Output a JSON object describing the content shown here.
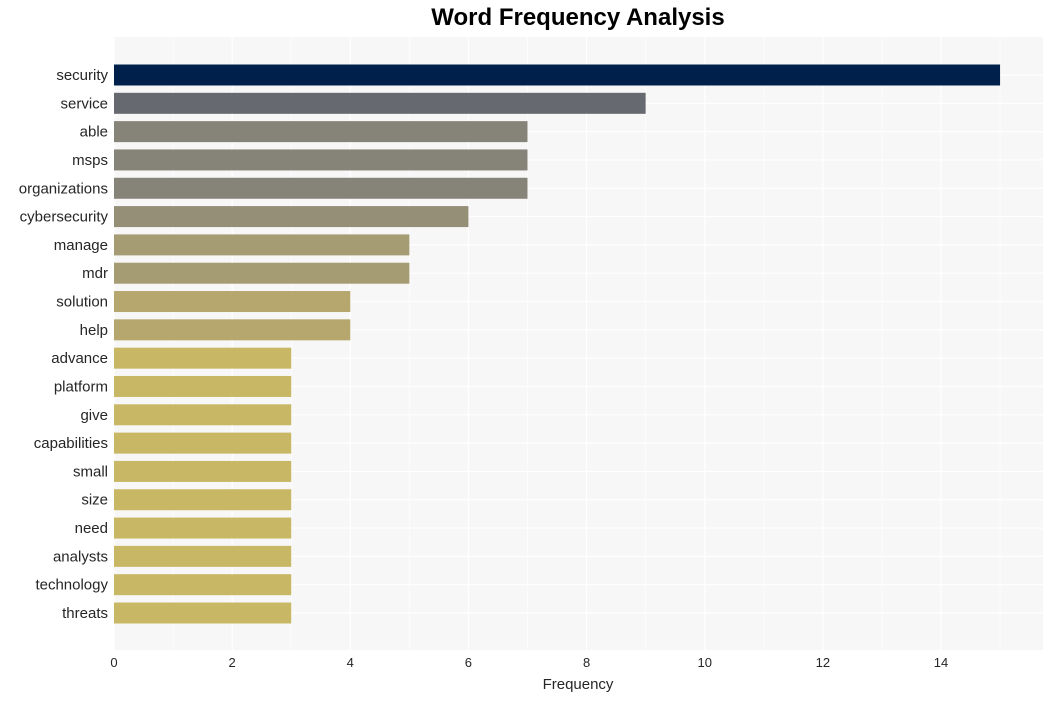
{
  "chart_data": {
    "type": "bar",
    "orientation": "horizontal",
    "title": "Word Frequency Analysis",
    "xlabel": "Frequency",
    "ylabel": "",
    "xlim": [
      0,
      15.7
    ],
    "xticks": [
      0,
      2,
      4,
      6,
      8,
      10,
      12,
      14
    ],
    "grid": true,
    "categories": [
      "security",
      "service",
      "able",
      "msps",
      "organizations",
      "cybersecurity",
      "manage",
      "mdr",
      "solution",
      "help",
      "advance",
      "platform",
      "give",
      "capabilities",
      "small",
      "size",
      "need",
      "analysts",
      "technology",
      "threats"
    ],
    "values": [
      15,
      9,
      7,
      7,
      7,
      6,
      5,
      5,
      4,
      4,
      3,
      3,
      3,
      3,
      3,
      3,
      3,
      3,
      3,
      3
    ],
    "colors": [
      "#00204c",
      "#676970",
      "#868379",
      "#868379",
      "#868379",
      "#958f78",
      "#a59c74",
      "#a59c74",
      "#b5a76e",
      "#b5a76e",
      "#c8b866",
      "#c8b866",
      "#c8b866",
      "#c8b866",
      "#c8b866",
      "#c8b866",
      "#c8b866",
      "#c8b866",
      "#c8b866",
      "#c8b866"
    ],
    "background": "#f7f7f7"
  }
}
